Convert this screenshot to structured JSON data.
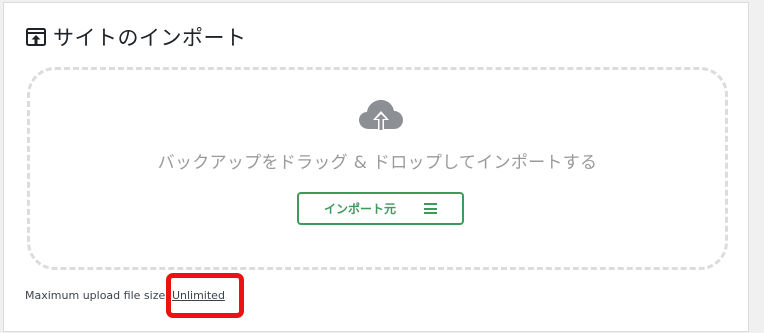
{
  "panel": {
    "title": "サイトのインポート",
    "title_icon": "upload-box-icon"
  },
  "dropzone": {
    "icon": "cloud-upload-icon",
    "text": "バックアップをドラッグ & ドロップしてインポートする",
    "import_button_label": "インポート元",
    "import_button_icon": "menu-icon"
  },
  "upload": {
    "label": "Maximum upload file size:",
    "value": "Unlimited"
  },
  "colors": {
    "accent_green": "#3d9a5b",
    "highlight_red": "#ee1111",
    "dropzone_border": "#dcdcde",
    "cloud_gray": "#8c8f94"
  }
}
